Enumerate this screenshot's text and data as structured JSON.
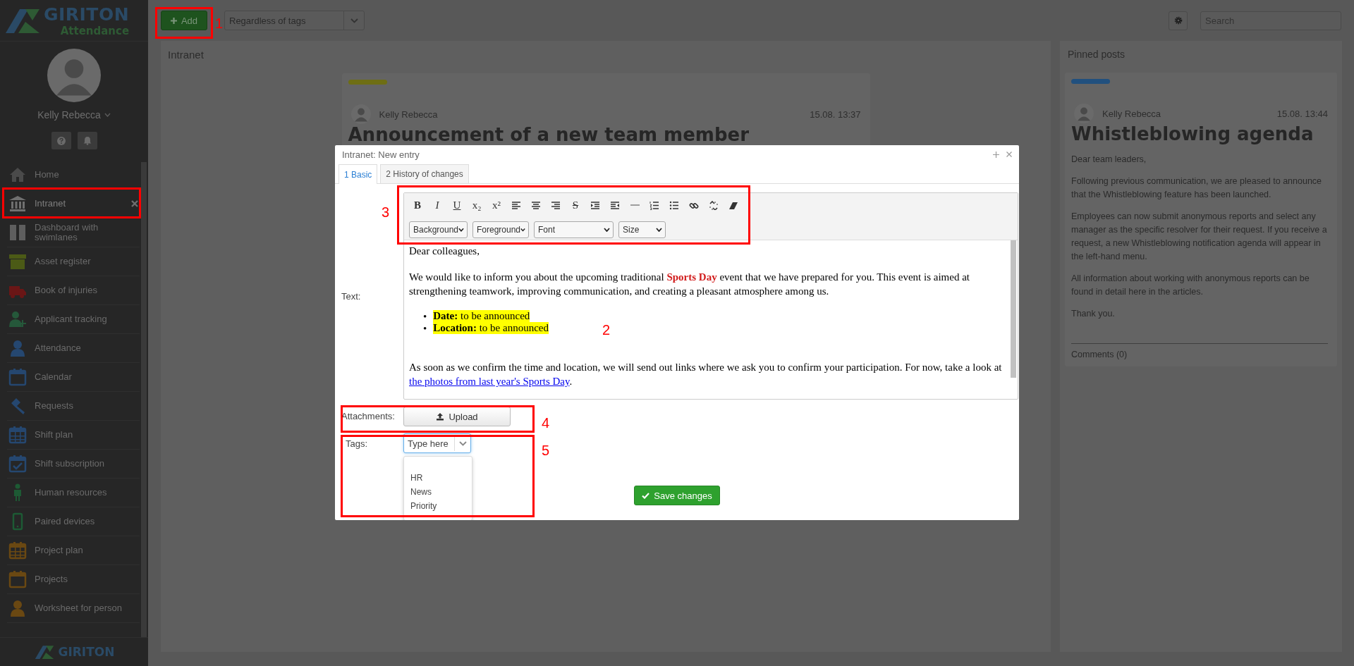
{
  "sidebar": {
    "logo": {
      "brand": "GIRITON",
      "product": "Attendance"
    },
    "user": {
      "name": "Kelly Rebecca"
    },
    "items": [
      {
        "label": "Home",
        "kind": "home",
        "color": "#4a4a4a",
        "selected": false,
        "highlighted": false
      },
      {
        "label": "Intranet",
        "kind": "bank",
        "color": "#707070",
        "selected": true,
        "highlighted": true
      },
      {
        "label": "Dashboard with swimlanes",
        "kind": "columns",
        "color": "#5e5e5e",
        "selected": false,
        "highlighted": false
      },
      {
        "label": "Asset register",
        "kind": "box",
        "color": "#4b5a16",
        "selected": false,
        "highlighted": false
      },
      {
        "label": "Book of injuries",
        "kind": "ambulance",
        "color": "#6a1616",
        "selected": false,
        "highlighted": false
      },
      {
        "label": "Applicant tracking",
        "kind": "user-plus",
        "color": "#25583a",
        "selected": false,
        "highlighted": false
      },
      {
        "label": "Attendance",
        "kind": "user",
        "color": "#254770",
        "selected": false,
        "highlighted": false
      },
      {
        "label": "Calendar",
        "kind": "calendar",
        "color": "#254770",
        "selected": false,
        "highlighted": false
      },
      {
        "label": "Requests",
        "kind": "gavel",
        "color": "#254770",
        "selected": false,
        "highlighted": false
      },
      {
        "label": "Shift plan",
        "kind": "calendar-grid",
        "color": "#254770",
        "selected": false,
        "highlighted": false
      },
      {
        "label": "Shift subscription",
        "kind": "calendar-check",
        "color": "#254770",
        "selected": false,
        "highlighted": false
      },
      {
        "label": "Human resources",
        "kind": "person",
        "color": "#1d5a34",
        "selected": false,
        "highlighted": false
      },
      {
        "label": "Paired devices",
        "kind": "phone",
        "color": "#1d5a34",
        "selected": false,
        "highlighted": false
      },
      {
        "label": "Project plan",
        "kind": "calendar-grid",
        "color": "#6a4812",
        "selected": false,
        "highlighted": false
      },
      {
        "label": "Projects",
        "kind": "calendar",
        "color": "#6a4812",
        "selected": false,
        "highlighted": false
      },
      {
        "label": "Worksheet for person",
        "kind": "user",
        "color": "#6a4812",
        "selected": false,
        "highlighted": false
      }
    ],
    "footer_logo": "GIRITON"
  },
  "toolbar": {
    "add_button": "Add",
    "tag_filter": "Regardless of tags",
    "search": {
      "placeholder": "Search"
    }
  },
  "intranet": {
    "title": "Intranet",
    "post": {
      "color": "#6e6e14",
      "author": "Kelly Rebecca",
      "time": "15.08. 13:37",
      "title": "Announcement of a new team member"
    }
  },
  "pinned": {
    "title": "Pinned posts",
    "post": {
      "color": "#21507e",
      "author": "Kelly Rebecca",
      "time": "15.08. 13:44",
      "title": "Whistleblowing agenda",
      "paragraphs": [
        "Dear team leaders,",
        "Following previous communication, we are pleased to announce that the Whistleblowing feature has been launched.",
        "Employees can now submit anonymous reports and select any manager as the specific resolver for their request. If you receive a request, a new Whistleblowing notification agenda will appear in the left-hand menu.",
        "All information about working with anonymous reports can be found in detail here in the articles.",
        "Thank you."
      ],
      "comments": "Comments (0)"
    }
  },
  "modal": {
    "title": "Intranet: New entry",
    "tabs": [
      {
        "label": "1 Basic",
        "selected": true
      },
      {
        "label": "2 History of changes",
        "selected": false
      }
    ],
    "text_label": "Text:",
    "tools": [
      {
        "kind": "bold",
        "label": "B"
      },
      {
        "kind": "italic",
        "label": "I"
      },
      {
        "kind": "underline",
        "label": "U"
      },
      {
        "kind": "subscript",
        "label": "x₂"
      },
      {
        "kind": "superscript",
        "label": "x²"
      },
      {
        "kind": "align-left"
      },
      {
        "kind": "align-center"
      },
      {
        "kind": "align-right"
      },
      {
        "kind": "strike",
        "label": "S"
      },
      {
        "kind": "indent"
      },
      {
        "kind": "outdent"
      },
      {
        "kind": "rule"
      },
      {
        "kind": "ordered-list"
      },
      {
        "kind": "bullet-list"
      },
      {
        "kind": "link"
      },
      {
        "kind": "unlink"
      },
      {
        "kind": "eraser"
      }
    ],
    "selects": [
      "Background",
      "Foreground",
      "Font",
      "Size"
    ],
    "content": {
      "greeting": "Dear colleagues,",
      "intro": "We would like to inform you about the upcoming traditional **Sports Day** event that we have prepared for you. This event is aimed at strengthening teamwork, improving communication, and creating a pleasant atmosphere among us.",
      "bullet": "•",
      "bullets": [
        "**Date:** to be announced",
        "**Location:** to be announced"
      ],
      "closing": {
        "text": "As soon as we confirm the time and location, we will send out links where we ask you to confirm your participation. For now, take a look at ",
        "link": "the photos from last year's Sports Day",
        "after": "."
      }
    },
    "attachments_label": "Attachments:",
    "upload_button": "Upload",
    "tags_label": "Tags:",
    "tags_field": {
      "placeholder": "Type here"
    },
    "tag_options": [
      "HR",
      "News",
      "Priority"
    ],
    "save_button": "Save changes"
  },
  "callouts": [
    {
      "label": "1"
    },
    {
      "label": "2"
    },
    {
      "label": "3"
    },
    {
      "label": "4"
    },
    {
      "label": "5"
    }
  ]
}
